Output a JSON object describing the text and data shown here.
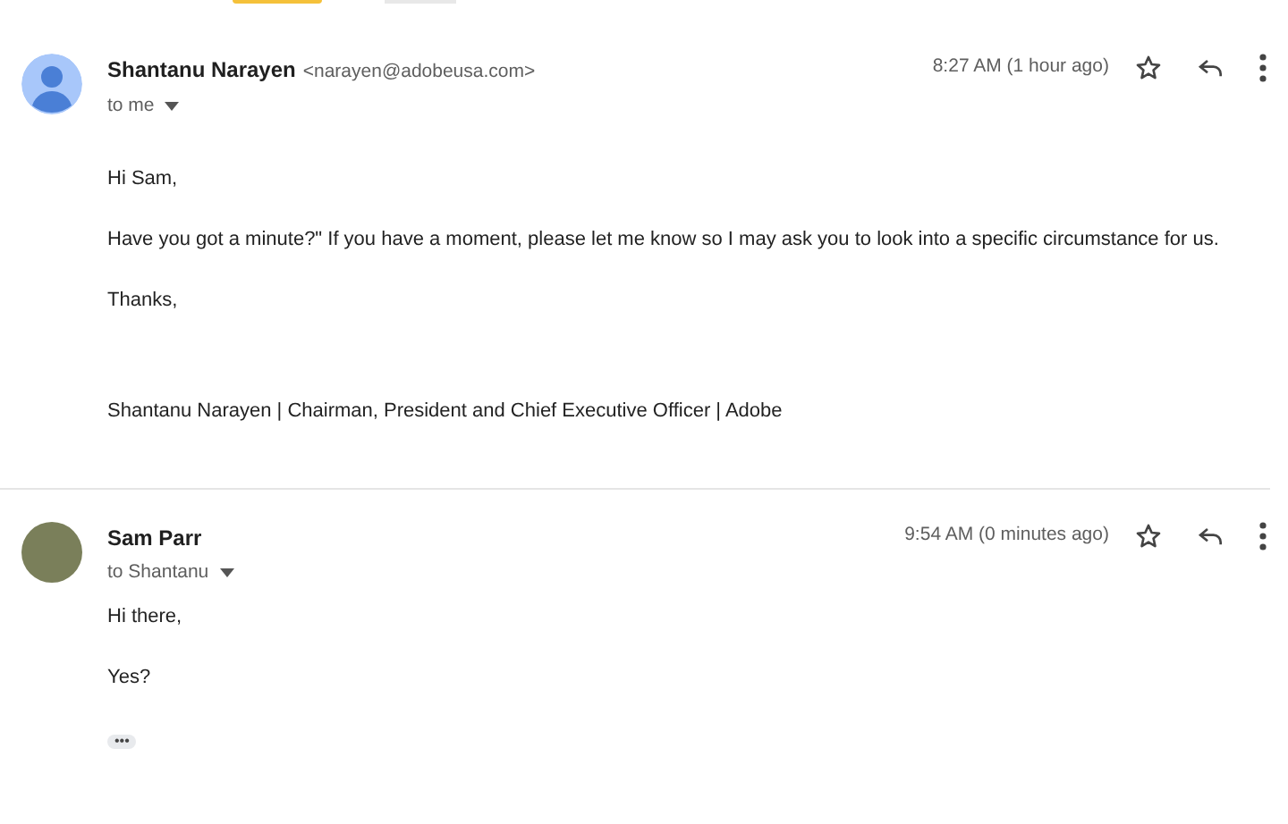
{
  "messages": [
    {
      "sender": "Shantanu Narayen",
      "email": "<narayen@adobeusa.com>",
      "recipient": "to me",
      "time": "8:27 AM (1 hour ago)",
      "kind": "placeholder",
      "starred": false,
      "paragraphs": [
        "Hi Sam,",
        "Have you got a minute?\" If you have a moment, please let me know so I may ask you to look into a specific circumstance for us.",
        "Thanks,"
      ],
      "signature": "Shantanu Narayen | Chairman, President and Chief Executive Officer | Adobe"
    },
    {
      "sender": "Sam Parr",
      "recipient": "to Shantanu",
      "time": "9:54 AM (0 minutes ago)",
      "kind": "photo",
      "starred": false,
      "paragraphs": [
        "Hi there,",
        "Yes?"
      ],
      "trimmed": "•••"
    }
  ]
}
